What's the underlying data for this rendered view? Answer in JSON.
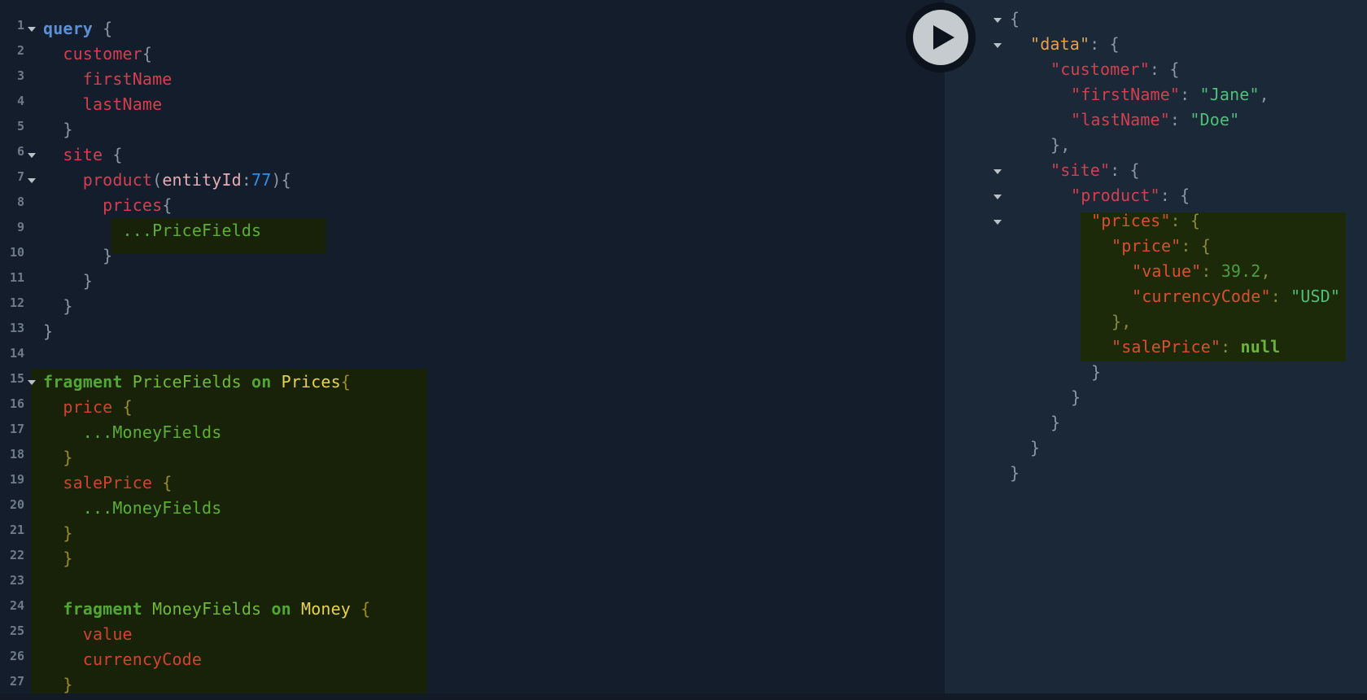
{
  "editor": {
    "line_numbers": [
      "1",
      "2",
      "3",
      "4",
      "5",
      "6",
      "7",
      "8",
      "9",
      "10",
      "11",
      "12",
      "13",
      "14",
      "15",
      "16",
      "17",
      "18",
      "19",
      "20",
      "21",
      "22",
      "23",
      "24",
      "25",
      "26",
      "27"
    ],
    "tokens": {
      "query": "query",
      "brace_open": "{",
      "brace_close": "}",
      "customer": "customer",
      "firstName": "firstName",
      "lastName": "lastName",
      "site": "site",
      "product": "product",
      "paren_open": "(",
      "entityId": "entityId",
      "colon": ":",
      "entity_value": "77",
      "paren_close": ")",
      "prices": "prices",
      "spread_price_fields": "...PriceFields",
      "fragment": "fragment",
      "price_fields": "PriceFields",
      "on": "on",
      "prices_type": "Prices",
      "price": "price",
      "spread_money_fields": "...MoneyFields",
      "salePrice": "salePrice",
      "money_fields": "MoneyFields",
      "money_type": "Money",
      "value": "value",
      "currencyCode": "currencyCode"
    }
  },
  "result": {
    "open": "{",
    "close": "}",
    "close_comma": "},",
    "data_key": "\"data\"",
    "customer_key": "\"customer\"",
    "firstName_key": "\"firstName\"",
    "firstName_val": "\"Jane\"",
    "lastName_key": "\"lastName\"",
    "lastName_val": "\"Doe\"",
    "site_key": "\"site\"",
    "product_key": "\"product\"",
    "prices_key": "\"prices\"",
    "price_key": "\"price\"",
    "value_key": "\"value\"",
    "value_val": "39.2",
    "currencyCode_key": "\"currencyCode\"",
    "currencyCode_val": "\"USD\"",
    "salePrice_key": "\"salePrice\"",
    "salePrice_val": "null",
    "sep": ": ",
    "comma": ","
  },
  "run_button": {
    "icon": "play-icon"
  }
}
